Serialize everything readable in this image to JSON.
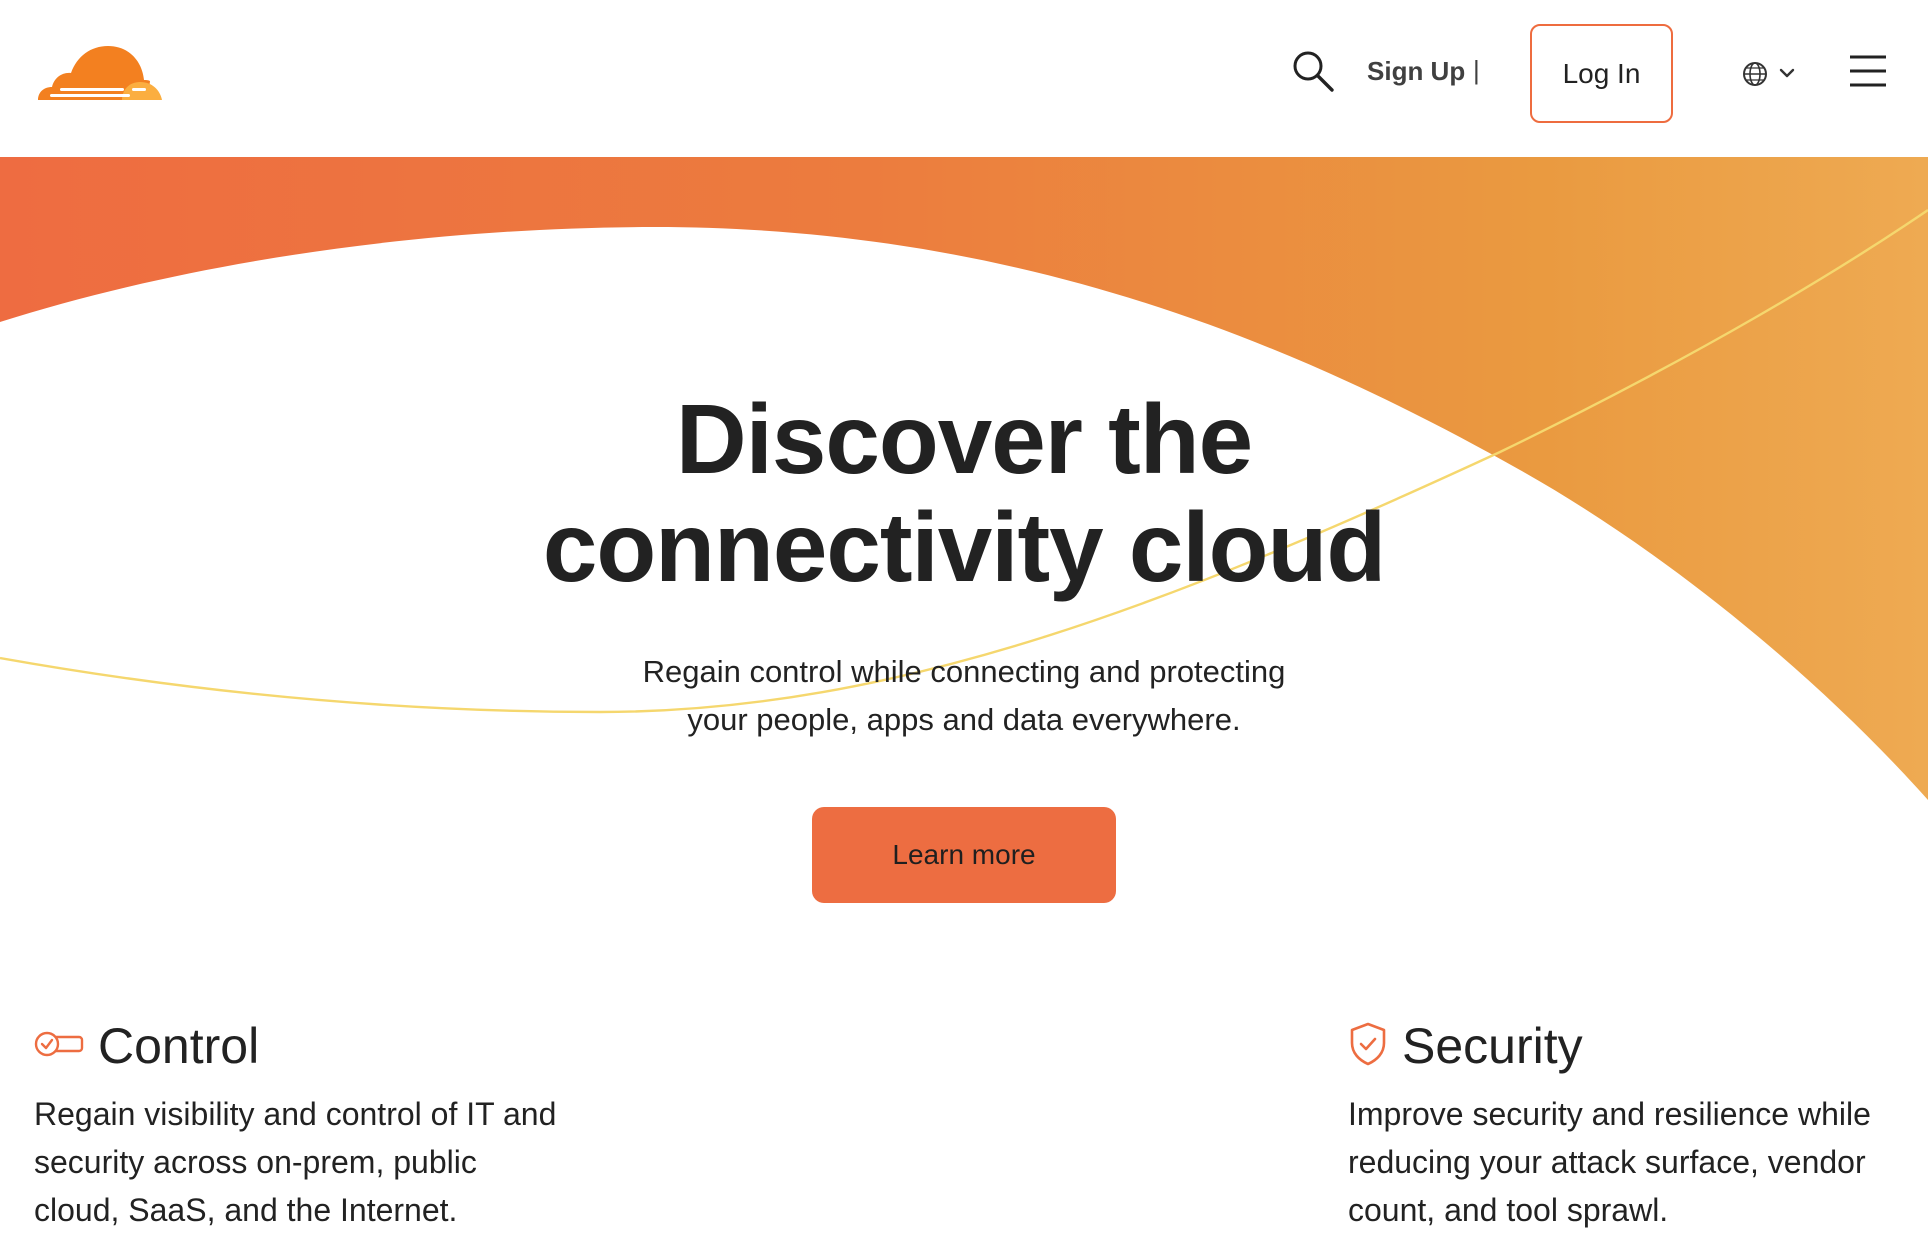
{
  "header": {
    "signup_label": "Sign Up",
    "divider": "|",
    "login_label": "Log In"
  },
  "icons": {
    "logo": "cloudflare-logo",
    "search": "search-icon",
    "language": "globe-icon",
    "language_chevron": "chevron-down-icon",
    "menu": "hamburger-menu-icon",
    "control": "toggle-check-icon",
    "security": "shield-check-icon"
  },
  "hero": {
    "title_line1": "Discover the",
    "title_line2": "connectivity cloud",
    "subtitle_line1": "Regain control while connecting and protecting",
    "subtitle_line2": "your people, apps and data everywhere.",
    "cta_label": "Learn more"
  },
  "features": [
    {
      "title": "Control",
      "text_line1": "Regain visibility and control of IT and",
      "text_line2": "security across on-prem, public",
      "text_line3": "cloud, SaaS, and the Internet."
    },
    {
      "title": "Security",
      "text_line1": "Improve security and resilience while",
      "text_line2": "reducing your attack surface, vendor",
      "text_line3": "count, and tool sprawl."
    }
  ],
  "colors": {
    "brand_orange": "#ed6d41",
    "gradient_start": "#ee6c41",
    "gradient_end": "#eea94f",
    "accent_line": "#f5d76e",
    "text": "#222222"
  }
}
